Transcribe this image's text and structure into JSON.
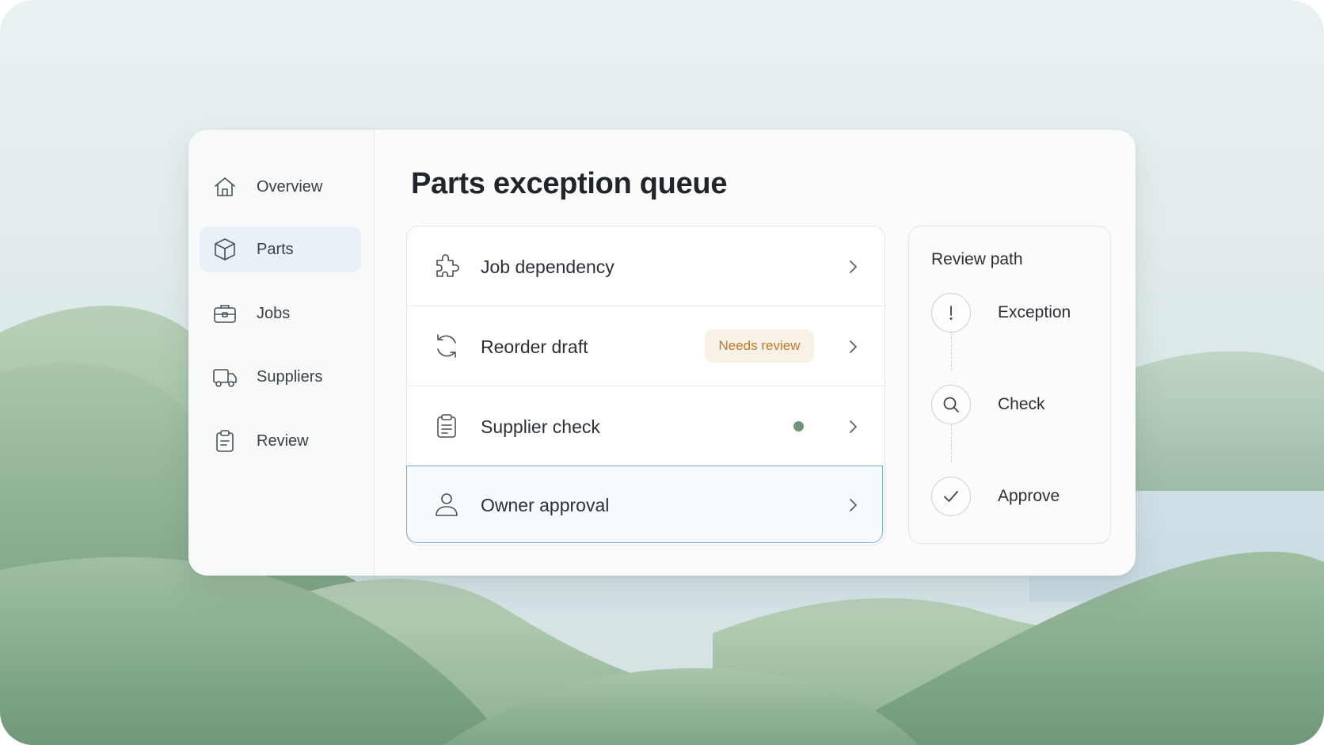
{
  "sidebar": {
    "items": [
      {
        "label": "Overview",
        "icon": "home-icon",
        "active": false
      },
      {
        "label": "Parts",
        "icon": "box-icon",
        "active": true
      },
      {
        "label": "Jobs",
        "icon": "briefcase-icon",
        "active": false
      },
      {
        "label": "Suppliers",
        "icon": "truck-icon",
        "active": false
      },
      {
        "label": "Review",
        "icon": "clipboard-icon",
        "active": false
      }
    ]
  },
  "main": {
    "title": "Parts exception queue",
    "rows": [
      {
        "label": "Job dependency",
        "icon": "puzzle-icon"
      },
      {
        "label": "Reorder draft",
        "icon": "refresh-icon",
        "badge": "Needs review"
      },
      {
        "label": "Supplier check",
        "icon": "clipboard-list-icon",
        "status": "green-dot"
      },
      {
        "label": "Owner approval",
        "icon": "user-icon",
        "selected": true
      }
    ]
  },
  "review_path": {
    "title": "Review path",
    "steps": [
      {
        "label": "Exception",
        "icon": "exclamation-icon"
      },
      {
        "label": "Check",
        "icon": "search-icon"
      },
      {
        "label": "Approve",
        "icon": "check-icon"
      }
    ]
  },
  "colors": {
    "accent": "#7aa7d8",
    "active_nav_bg": "#e9f1f8",
    "badge_bg": "#f8f1e6",
    "badge_text": "#bd7a2a",
    "status_dot": "#6d9676"
  }
}
